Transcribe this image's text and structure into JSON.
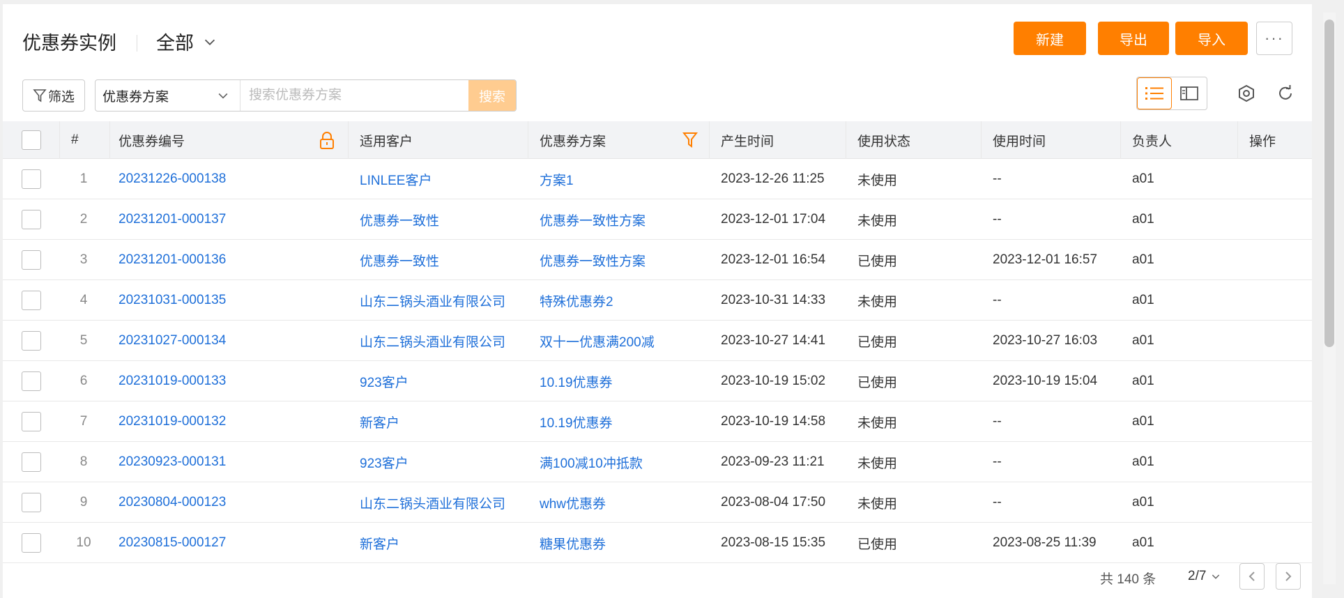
{
  "header": {
    "title": "优惠券实例",
    "view_selector": "全部",
    "buttons": {
      "new": "新建",
      "export": "导出",
      "import": "导入"
    },
    "more_label": "···"
  },
  "toolbar": {
    "filter_label": "筛选",
    "search_scope": "优惠券方案",
    "search_placeholder": "搜索优惠券方案",
    "search_button": "搜索"
  },
  "table": {
    "headers": {
      "index": "#",
      "code": "优惠券编号",
      "customer": "适用客户",
      "plan": "优惠券方案",
      "created": "产生时间",
      "status": "使用状态",
      "used_time": "使用时间",
      "owner": "负责人",
      "actions": "操作"
    },
    "rows": [
      {
        "idx": "1",
        "code": "20231226-000138",
        "customer": "LINLEE客户",
        "plan": "方案1",
        "created": "2023-12-26 11:25",
        "status": "未使用",
        "used_time": "--",
        "owner": "a01"
      },
      {
        "idx": "2",
        "code": "20231201-000137",
        "customer": "优惠券一致性",
        "plan": "优惠券一致性方案",
        "created": "2023-12-01 17:04",
        "status": "未使用",
        "used_time": "--",
        "owner": "a01"
      },
      {
        "idx": "3",
        "code": "20231201-000136",
        "customer": "优惠券一致性",
        "plan": "优惠券一致性方案",
        "created": "2023-12-01 16:54",
        "status": "已使用",
        "used_time": "2023-12-01 16:57",
        "owner": "a01"
      },
      {
        "idx": "4",
        "code": "20231031-000135",
        "customer": "山东二锅头酒业有限公司",
        "plan": "特殊优惠券2",
        "created": "2023-10-31 14:33",
        "status": "未使用",
        "used_time": "--",
        "owner": "a01"
      },
      {
        "idx": "5",
        "code": "20231027-000134",
        "customer": "山东二锅头酒业有限公司",
        "plan": "双十一优惠满200减",
        "created": "2023-10-27 14:41",
        "status": "已使用",
        "used_time": "2023-10-27 16:03",
        "owner": "a01"
      },
      {
        "idx": "6",
        "code": "20231019-000133",
        "customer": "923客户",
        "plan": "10.19优惠券",
        "created": "2023-10-19 15:02",
        "status": "已使用",
        "used_time": "2023-10-19 15:04",
        "owner": "a01"
      },
      {
        "idx": "7",
        "code": "20231019-000132",
        "customer": "新客户",
        "plan": "10.19优惠券",
        "created": "2023-10-19 14:58",
        "status": "未使用",
        "used_time": "--",
        "owner": "a01"
      },
      {
        "idx": "8",
        "code": "20230923-000131",
        "customer": "923客户",
        "plan": "满100减10冲抵款",
        "created": "2023-09-23 11:21",
        "status": "未使用",
        "used_time": "--",
        "owner": "a01"
      },
      {
        "idx": "9",
        "code": "20230804-000123",
        "customer": "山东二锅头酒业有限公司",
        "plan": "whw优惠券",
        "created": "2023-08-04 17:50",
        "status": "未使用",
        "used_time": "--",
        "owner": "a01"
      },
      {
        "idx": "10",
        "code": "20230815-000127",
        "customer": "新客户",
        "plan": "糖果优惠券",
        "created": "2023-08-15 15:35",
        "status": "已使用",
        "used_time": "2023-08-25 11:39",
        "owner": "a01"
      }
    ]
  },
  "footer": {
    "total": "共 140 条",
    "page": "2/7"
  },
  "colors": {
    "accent": "#ff7f00",
    "link": "#1e6fd9",
    "search_button_bg": "#ffcc90"
  },
  "icons": [
    "chevron-down-icon",
    "filter-icon",
    "list-view-icon",
    "card-view-icon",
    "settings-icon",
    "refresh-icon",
    "lock-icon",
    "column-filter-icon",
    "prev-page-icon",
    "next-page-icon"
  ]
}
